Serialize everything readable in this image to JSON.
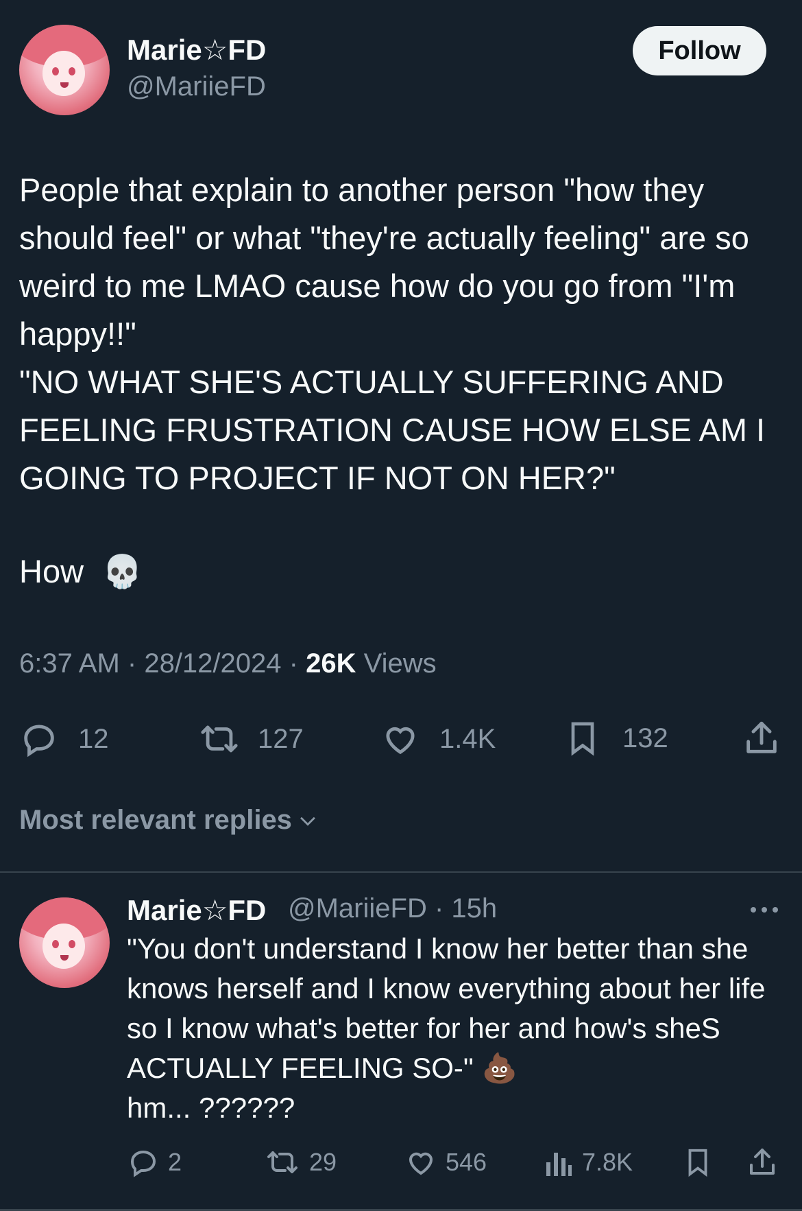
{
  "tweet": {
    "author_name": "Marie☆FD",
    "author_handle": "@MariieFD",
    "follow_label": "Follow",
    "text": "People that explain to another person \"how they should feel\" or what \"they're actually feeling\" are so weird to me LMAO cause how do you go from \"I'm happy!!\"\n\"NO WHAT SHE'S ACTUALLY SUFFERING AND FEELING FRUSTRATION CAUSE HOW ELSE AM I GOING TO PROJECT IF NOT ON HER?\"",
    "last_line": "How",
    "last_emoji": "💀",
    "time": "6:37 AM",
    "date": "28/12/2024",
    "views_count": "26K",
    "views_label": "Views",
    "replies": "12",
    "reposts": "127",
    "likes": "1.4K",
    "bookmarks": "132"
  },
  "replies_sort": {
    "label": "Most relevant replies"
  },
  "reply": {
    "author_name": "Marie☆FD",
    "author_handle": "@MariieFD",
    "age": "15h",
    "text": "\"You don't understand I know her better than she knows herself and I know everything about her life so I know what's better for her and how's sheS ACTUALLY FEELING SO-\" 💩\nhm... ??????",
    "replies": "2",
    "reposts": "29",
    "likes": "546",
    "views": "7.8K"
  },
  "colors": {
    "background": "#15202b",
    "text": "#f7f9f9",
    "secondary": "#8b98a5",
    "follow_bg": "#eff3f4"
  }
}
